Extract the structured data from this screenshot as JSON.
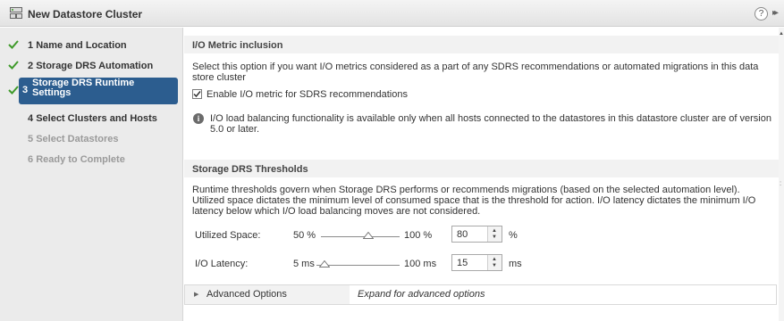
{
  "window": {
    "title": "New Datastore Cluster",
    "help_glyph": "?",
    "expand_glyph": "▸▸"
  },
  "steps": [
    {
      "number": "1",
      "label": "Name and Location",
      "state": "completed"
    },
    {
      "number": "2",
      "label": "Storage DRS Automation",
      "state": "completed"
    },
    {
      "number": "3",
      "label": "Storage DRS Runtime Settings",
      "state": "active"
    },
    {
      "number": "4",
      "label": "Select Clusters and Hosts",
      "state": "enabled"
    },
    {
      "number": "5",
      "label": "Select Datastores",
      "state": "disabled"
    },
    {
      "number": "6",
      "label": "Ready to Complete",
      "state": "disabled"
    }
  ],
  "io_metric": {
    "heading": "I/O Metric inclusion",
    "description": "Select this option if you want I/O metrics considered as a part of any SDRS recommendations or automated migrations in this data store cluster",
    "checkbox_label": "Enable I/O metric for SDRS recommendations",
    "checkbox_checked": true,
    "info_text": "I/O load balancing functionality is available only when all hosts connected to the datastores in this datastore cluster are of version 5.0 or later."
  },
  "thresholds": {
    "heading": "Storage DRS Thresholds",
    "description": "Runtime thresholds govern when Storage DRS performs or recommends migrations (based on the selected automation level). Utilized space dictates the minimum level of consumed space that is the threshold for action. I/O latency dictates the minimum I/O latency below which I/O load balancing moves are not considered.",
    "utilized_space": {
      "label": "Utilized Space:",
      "min": "50 %",
      "max": "100 %",
      "value": "80",
      "unit": "%",
      "slider_fraction": 0.6
    },
    "io_latency": {
      "label": "I/O Latency:",
      "min": "5 ms",
      "max": "100 ms",
      "value": "15",
      "unit": "ms",
      "slider_fraction": 0.1
    }
  },
  "advanced": {
    "label": "Advanced Options",
    "description": "Expand for advanced options"
  },
  "colors": {
    "active_step": "#2c5d8f",
    "check": "#3f9a2a"
  }
}
